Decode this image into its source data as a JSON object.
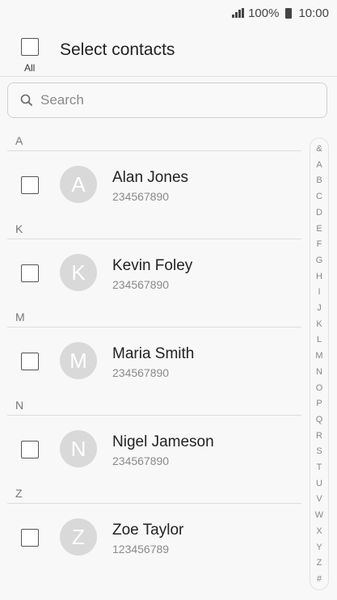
{
  "status_bar": {
    "battery": "100%",
    "time": "10:00"
  },
  "header": {
    "all_label": "All",
    "title": "Select contacts"
  },
  "search": {
    "placeholder": "Search"
  },
  "sections": [
    {
      "letter": "A",
      "contact": {
        "initial": "A",
        "name": "Alan Jones",
        "phone": "234567890"
      }
    },
    {
      "letter": "K",
      "contact": {
        "initial": "K",
        "name": "Kevin Foley",
        "phone": "234567890"
      }
    },
    {
      "letter": "M",
      "contact": {
        "initial": "M",
        "name": "Maria Smith",
        "phone": "234567890"
      }
    },
    {
      "letter": "N",
      "contact": {
        "initial": "N",
        "name": "Nigel Jameson",
        "phone": "234567890"
      }
    },
    {
      "letter": "Z",
      "contact": {
        "initial": "Z",
        "name": "Zoe Taylor",
        "phone": "123456789"
      }
    }
  ],
  "index_letters": [
    "&",
    "A",
    "B",
    "C",
    "D",
    "E",
    "F",
    "G",
    "H",
    "I",
    "J",
    "K",
    "L",
    "M",
    "N",
    "O",
    "P",
    "Q",
    "R",
    "S",
    "T",
    "U",
    "V",
    "W",
    "X",
    "Y",
    "Z",
    "#"
  ]
}
